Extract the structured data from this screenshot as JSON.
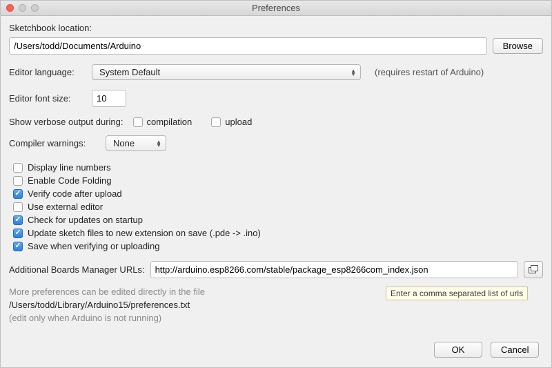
{
  "window": {
    "title": "Preferences"
  },
  "sketchbook": {
    "label": "Sketchbook location:",
    "path": "/Users/todd/Documents/Arduino",
    "browse": "Browse"
  },
  "editor_language": {
    "label": "Editor language:",
    "value": "System Default",
    "hint": "(requires restart of Arduino)"
  },
  "editor_font_size": {
    "label": "Editor font size:",
    "value": "10"
  },
  "verbose": {
    "label": "Show verbose output during:",
    "compilation_label": "compilation",
    "upload_label": "upload"
  },
  "compiler_warnings": {
    "label": "Compiler warnings:",
    "value": "None"
  },
  "checks": {
    "display_line_numbers": "Display line numbers",
    "enable_code_folding": "Enable Code Folding",
    "verify_code_after_upload": "Verify code after upload",
    "use_external_editor": "Use external editor",
    "check_updates": "Check for updates on startup",
    "update_ext": "Update sketch files to new extension on save (.pde -> .ino)",
    "save_when_verifying": "Save when verifying or uploading"
  },
  "boards_url": {
    "label": "Additional Boards Manager URLs:",
    "value": "http://arduino.esp8266.com/stable/package_esp8266com_index.json",
    "tooltip": "Enter a comma separated list of urls"
  },
  "more_prefs": {
    "line1": "More preferences can be edited directly in the file",
    "path": "/Users/todd/Library/Arduino15/preferences.txt",
    "line3": "(edit only when Arduino is not running)"
  },
  "buttons": {
    "ok": "OK",
    "cancel": "Cancel"
  }
}
